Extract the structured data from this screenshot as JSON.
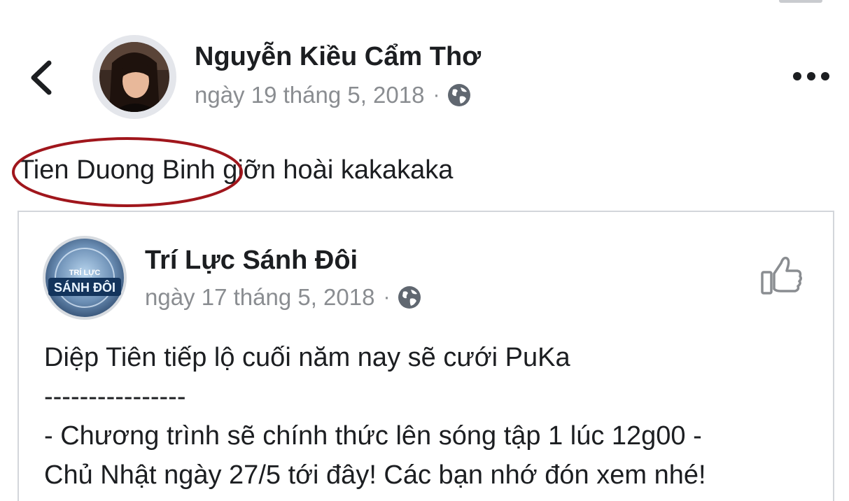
{
  "post": {
    "author": "Nguyễn Kiều Cẩm Thơ",
    "date": "ngày 19 tháng 5, 2018",
    "separator": "·",
    "privacy_icon": "globe-icon",
    "text_mention": "Tien Duong Binh",
    "text_rest": " giỡn hoài kakakaka",
    "annotation_color": "#a0161c"
  },
  "shared": {
    "page_name": "Trí Lực Sánh Đôi",
    "date": "ngày 17 tháng 5, 2018",
    "separator": "·",
    "privacy_icon": "globe-icon",
    "logo_text_top": "TRÍ LỰC",
    "logo_text_bottom": "SÁNH ĐÔI",
    "lines": [
      "Diệp Tiên tiếp lộ cuối năm nay sẽ cưới PuKa",
      "----------------",
      "- Chương trình sẽ chính thức lên sóng tập 1 lúc 12g00 -",
      "Chủ Nhật ngày 27/5 tới đây! Các bạn nhớ đón xem nhé!"
    ]
  },
  "icons": {
    "back": "chevron-left-icon",
    "more": "more-horizontal-icon",
    "like": "thumbs-up-icon"
  },
  "colors": {
    "text": "#1c1e21",
    "meta": "#8a8d91",
    "border": "#d3d6db"
  }
}
